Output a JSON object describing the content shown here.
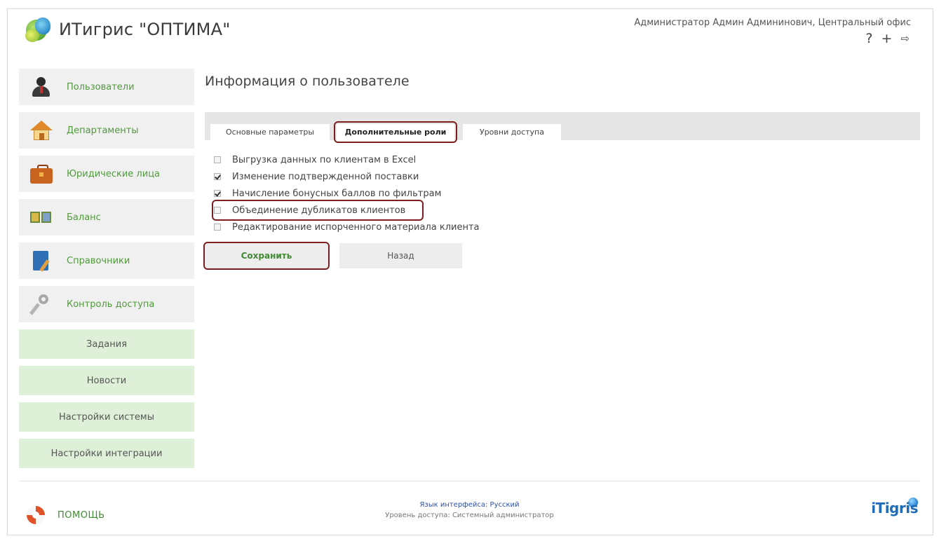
{
  "app": {
    "title": "ИТигрис \"ОПТИМА\"",
    "user": "Администратор Админ Админинович, Центральный офис",
    "icons": {
      "help": "?",
      "add": "+",
      "logout": "⇨"
    }
  },
  "sidebar": {
    "items": [
      {
        "label": "Пользователи",
        "icon": "user-icon"
      },
      {
        "label": "Департаменты",
        "icon": "home-icon"
      },
      {
        "label": "Юридические лица",
        "icon": "briefcase-icon"
      },
      {
        "label": "Баланс",
        "icon": "balance-icon"
      },
      {
        "label": "Справочники",
        "icon": "book-icon"
      },
      {
        "label": "Контроль доступа",
        "icon": "key-icon"
      }
    ],
    "subitems": [
      {
        "label": "Задания"
      },
      {
        "label": "Новости"
      },
      {
        "label": "Настройки системы"
      },
      {
        "label": "Настройки интеграции"
      }
    ]
  },
  "main": {
    "title": "Информация о пользователе",
    "tabs": [
      {
        "label": "Основные параметры"
      },
      {
        "label": "Дополнительные роли"
      },
      {
        "label": "Уровни доступа"
      }
    ],
    "roles": [
      {
        "label": "Выгрузка данных по клиентам в Excel",
        "checked": false
      },
      {
        "label": "Изменение подтвержденной поставки",
        "checked": true
      },
      {
        "label": "Начисление бонусных баллов по фильтрам",
        "checked": true
      },
      {
        "label": "Объединение дубликатов клиентов",
        "checked": false
      },
      {
        "label": "Редактирование испорченного материала клиента",
        "checked": false
      }
    ],
    "save_label": "Сохранить",
    "back_label": "Назад"
  },
  "footer": {
    "help_label": "ПОМОЩЬ",
    "language": "Язык интерфейса: Русский",
    "access_level": "Уровень доступа: Системный администратор",
    "brand": "iTigris"
  },
  "colors": {
    "accent_green": "#4f9a3a",
    "highlight_border": "#7a1f22",
    "submenu_bg": "#dff0d8",
    "brand_blue": "#1f6db8"
  }
}
